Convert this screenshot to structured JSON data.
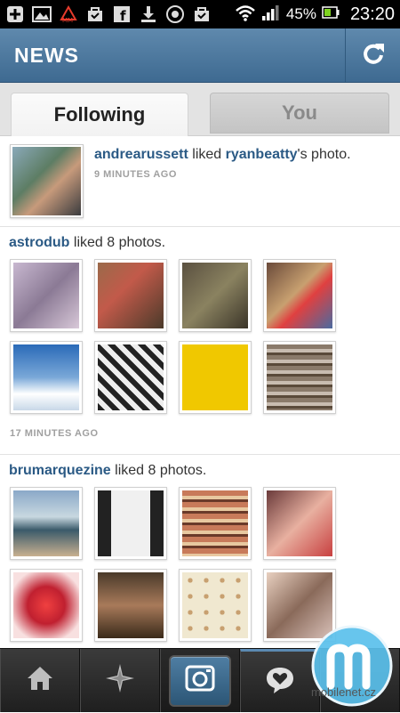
{
  "status_bar": {
    "battery_percent": "45%",
    "time": "23:20"
  },
  "header": {
    "title": "NEWS"
  },
  "tabs": [
    {
      "label": "Following",
      "active": true
    },
    {
      "label": "You",
      "active": false
    }
  ],
  "feed": {
    "item1": {
      "user": "andrearussett",
      "action": " liked ",
      "target": "ryanbeatty",
      "suffix": "'s photo.",
      "time": "9 MINUTES AGO"
    },
    "item2": {
      "user": "astrodub",
      "action": " liked 8 photos.",
      "time": "17 MINUTES AGO"
    },
    "item3": {
      "user": "brumarquezine",
      "action": " liked 8 photos."
    }
  },
  "watermark": {
    "text": "mobilenet.cz"
  },
  "colors": {
    "header": "#4b76a0",
    "link": "#2b5a85",
    "timestamp": "#a0a0a0"
  }
}
